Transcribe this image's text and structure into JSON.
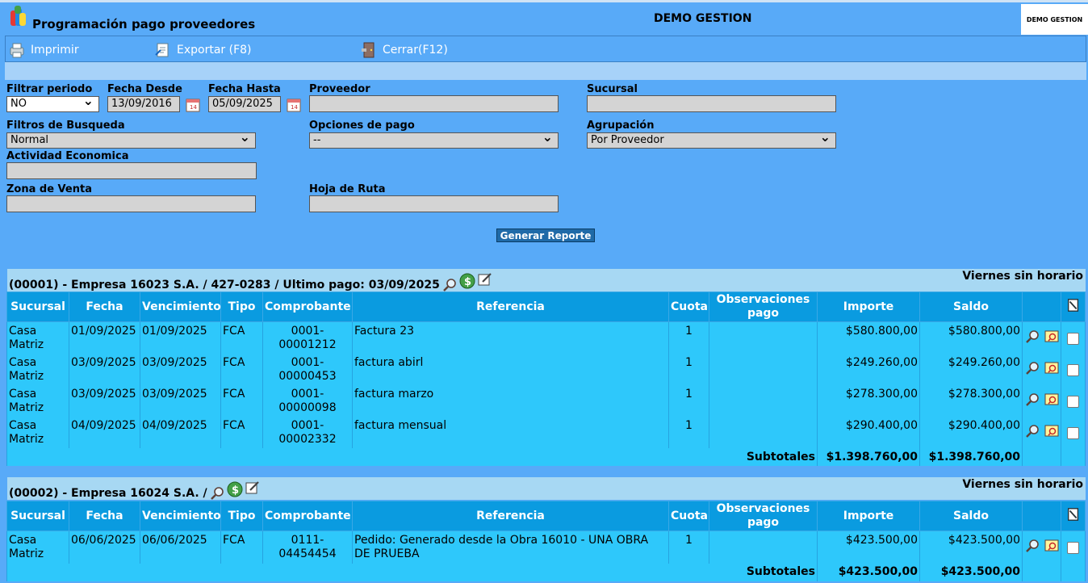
{
  "header": {
    "title": "Programación pago proveedores",
    "company": "DEMO GESTION",
    "brand": "DEMO GESTION"
  },
  "toolbar": {
    "print": "Imprimir",
    "export": "Exportar (F8)",
    "close": "Cerrar(F12)"
  },
  "filters": {
    "period_label": "Filtrar periodo",
    "period_value": "NO",
    "from_label": "Fecha Desde",
    "from_value": "13/09/2016",
    "to_label": "Fecha Hasta",
    "to_value": "05/09/2025",
    "supplier_label": "Proveedor",
    "supplier_value": "",
    "branch_label": "Sucursal",
    "branch_value": "",
    "search_label": "Filtros de Busqueda",
    "search_value": "Normal",
    "payment_label": "Opciones de pago",
    "payment_value": "--",
    "group_label": "Agrupación",
    "group_value": "Por Proveedor",
    "activity_label": "Actividad Economica",
    "activity_value": "",
    "zone_label": "Zona de Venta",
    "zone_value": "",
    "route_label": "Hoja de Ruta",
    "route_value": "",
    "generate": "Generar Reporte"
  },
  "columns": [
    "Sucursal",
    "Fecha",
    "Vencimiento",
    "Tipo",
    "Comprobante",
    "Referencia",
    "Cuota",
    "Observaciones pago",
    "Importe",
    "Saldo"
  ],
  "groups": [
    {
      "title": "(00001) - Empresa 16023 S.A. / 427-0283 / Ultimo pago: 03/09/2025",
      "note": "Viernes sin horario",
      "rows": [
        {
          "sucursal": "Casa Matriz",
          "fecha": "01/09/2025",
          "venc": "01/09/2025",
          "tipo": "FCA",
          "comp": "0001-00001212",
          "ref": "Factura 23",
          "cuota": "1",
          "obs": "",
          "importe": "$580.800,00",
          "saldo": "$580.800,00"
        },
        {
          "sucursal": "Casa Matriz",
          "fecha": "03/09/2025",
          "venc": "03/09/2025",
          "tipo": "FCA",
          "comp": "0001-00000453",
          "ref": "factura abirl",
          "cuota": "1",
          "obs": "",
          "importe": "$249.260,00",
          "saldo": "$249.260,00"
        },
        {
          "sucursal": "Casa Matriz",
          "fecha": "03/09/2025",
          "venc": "03/09/2025",
          "tipo": "FCA",
          "comp": "0001-00000098",
          "ref": "factura marzo",
          "cuota": "1",
          "obs": "",
          "importe": "$278.300,00",
          "saldo": "$278.300,00"
        },
        {
          "sucursal": "Casa Matriz",
          "fecha": "04/09/2025",
          "venc": "04/09/2025",
          "tipo": "FCA",
          "comp": "0001-00002332",
          "ref": "factura mensual",
          "cuota": "1",
          "obs": "",
          "importe": "$290.400,00",
          "saldo": "$290.400,00"
        }
      ],
      "subtotal_label": "Subtotales",
      "subtotal_importe": "$1.398.760,00",
      "subtotal_saldo": "$1.398.760,00"
    },
    {
      "title": "(00002) - Empresa 16024 S.A. /",
      "note": "Viernes sin horario",
      "rows": [
        {
          "sucursal": "Casa Matriz",
          "fecha": "06/06/2025",
          "venc": "06/06/2025",
          "tipo": "FCA",
          "comp": "0111-04454454",
          "ref": "Pedido: Generado desde la Obra 16010 - UNA OBRA DE PRUEBA",
          "cuota": "1",
          "obs": "",
          "importe": "$423.500,00",
          "saldo": "$423.500,00"
        }
      ],
      "subtotal_label": "Subtotales",
      "subtotal_importe": "$423.500,00",
      "subtotal_saldo": "$423.500,00"
    }
  ]
}
